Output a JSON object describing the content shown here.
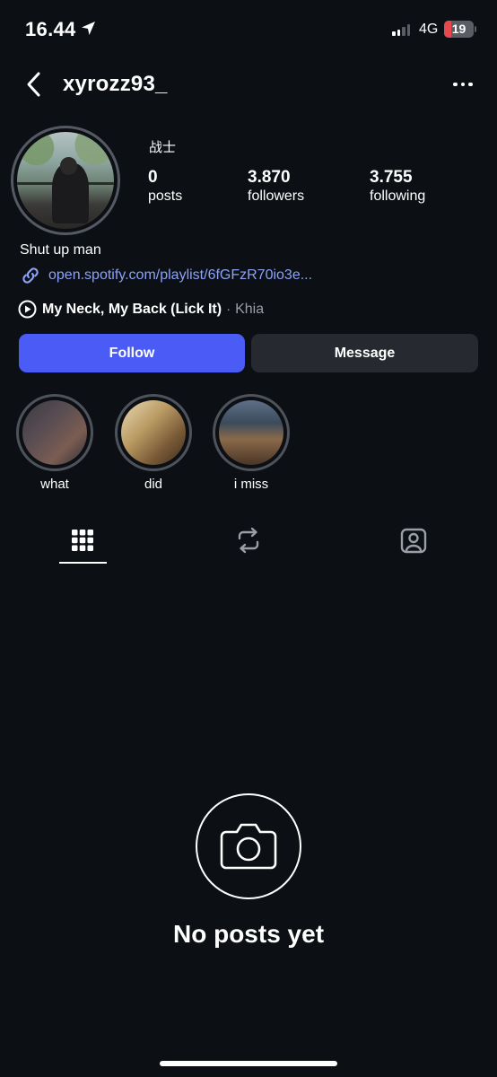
{
  "status_bar": {
    "time": "16.44",
    "network": "4G",
    "battery_level": "19",
    "battery_fraction": 0.19,
    "signal_bars_active": 2,
    "signal_bars_total": 4,
    "icons": [
      "location-arrow-icon",
      "signal-icon",
      "battery-icon"
    ]
  },
  "header": {
    "username": "xyrozz93_",
    "back_icon": "chevron-left-icon",
    "more_icon": "more-horizontal-icon"
  },
  "profile": {
    "display_name": "战士",
    "stats": [
      {
        "value": "0",
        "label": "posts"
      },
      {
        "value": "3.870",
        "label": "followers"
      },
      {
        "value": "3.755",
        "label": "following"
      }
    ],
    "bio": "Shut up man",
    "link": "open.spotify.com/playlist/6fGFzR70io3e...",
    "music": {
      "title": "My Neck, My Back (Lick It)",
      "separator": "·",
      "artist": "Khia"
    }
  },
  "actions": {
    "follow_label": "Follow",
    "message_label": "Message"
  },
  "highlights": [
    {
      "label": "what"
    },
    {
      "label": "did"
    },
    {
      "label": "i miss"
    }
  ],
  "tabs": [
    {
      "name": "grid-icon",
      "active": true
    },
    {
      "name": "reposts-icon",
      "active": false
    },
    {
      "name": "tagged-icon",
      "active": false
    }
  ],
  "empty_state": {
    "icon": "camera-icon",
    "title": "No posts yet"
  },
  "colors": {
    "background": "#0c0f14",
    "accent": "#4a5cf5",
    "link": "#8ba2f6",
    "battery_low": "#e5484d"
  }
}
